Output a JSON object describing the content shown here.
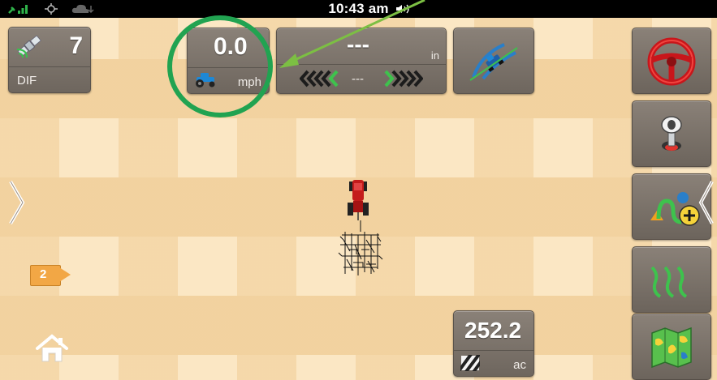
{
  "status_bar": {
    "time": "10:43 am",
    "icons": [
      "gps-signal-icon",
      "network-icon",
      "cloud-icon",
      "volume-icon"
    ]
  },
  "gps_tile": {
    "satellites": "7",
    "mode": "DIF",
    "icon": "satellite-icon"
  },
  "speed_tile": {
    "value": "0.0",
    "unit": "mph",
    "icon": "tractor-icon"
  },
  "offset_tile": {
    "value": "---",
    "unit": "in",
    "arrow_value": "---"
  },
  "guidance_tile": {
    "icon": "implement-guidance-icon"
  },
  "area_tile": {
    "value": "252.2",
    "unit": "ac",
    "icon": "hatch-area-icon"
  },
  "camera": {
    "number": "2"
  },
  "right_column": [
    {
      "name": "steering-wheel-icon"
    },
    {
      "name": "joystick-switch-icon"
    },
    {
      "name": "add-guidance-line-icon"
    },
    {
      "name": "guidance-curves-icon"
    },
    {
      "name": "field-map-icon"
    }
  ],
  "colors": {
    "tile": "#7c746b",
    "accent_green": "#21a351",
    "field_light": "#fbe7c4",
    "field_dark": "#f3d4a2"
  }
}
